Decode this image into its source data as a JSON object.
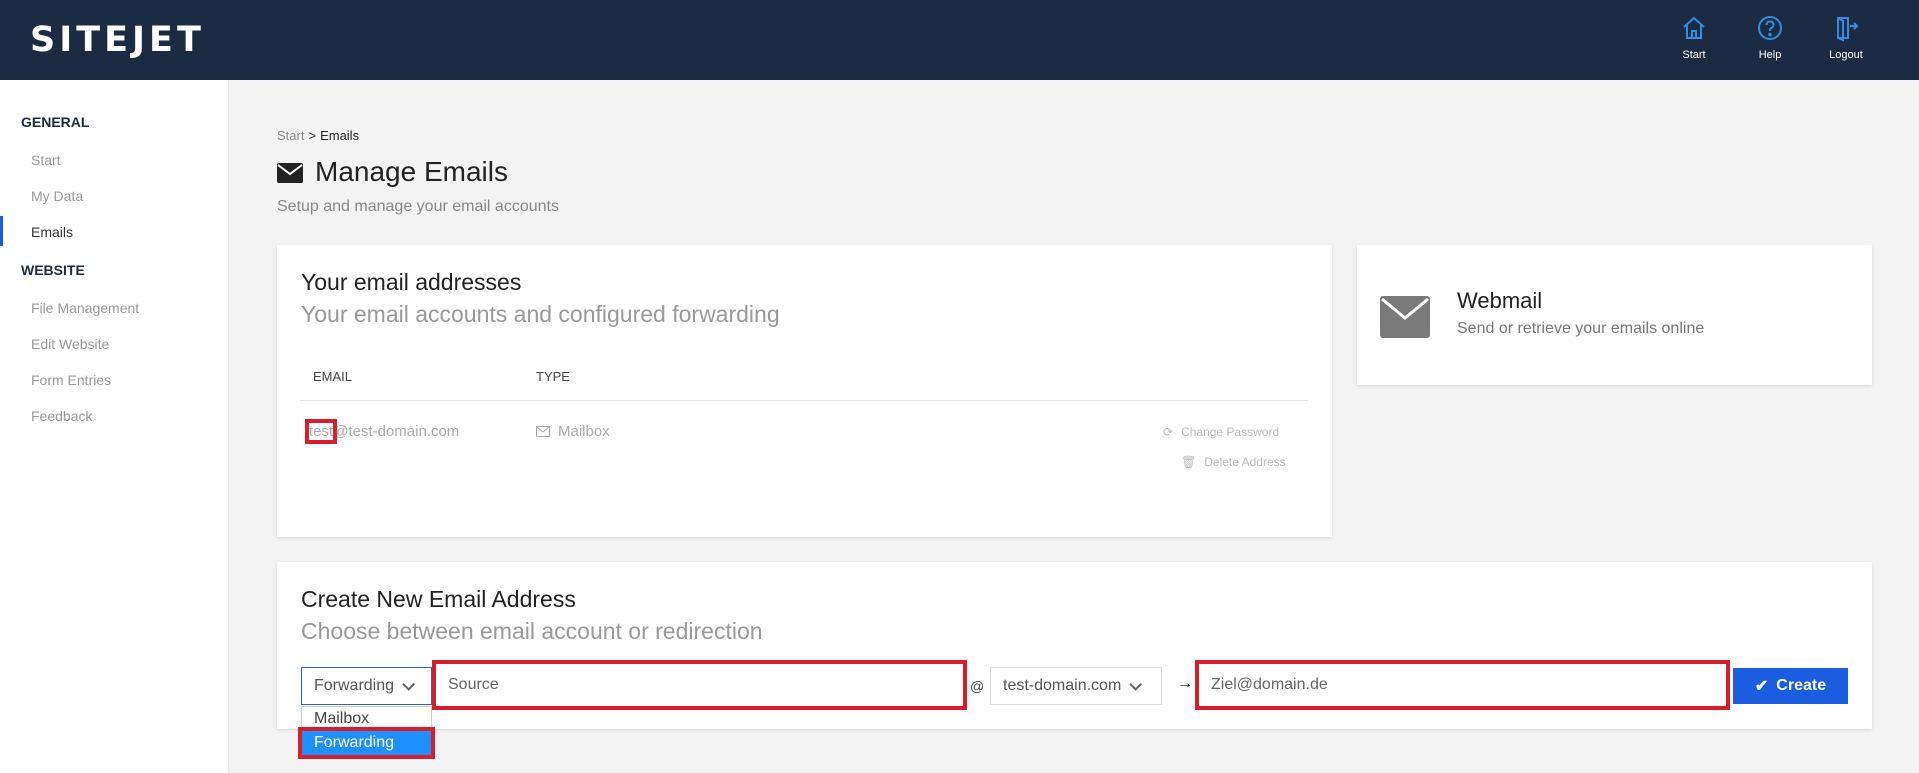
{
  "header": {
    "logo": "SITEJET",
    "nav": [
      {
        "label": "Start",
        "icon": "home-icon"
      },
      {
        "label": "Help",
        "icon": "help-icon"
      },
      {
        "label": "Logout",
        "icon": "logout-icon"
      }
    ]
  },
  "sidebar": {
    "general_heading": "GENERAL",
    "general_items": [
      "Start",
      "My Data",
      "Emails"
    ],
    "website_heading": "WEBSITE",
    "website_items": [
      "File Management",
      "Edit Website",
      "Form Entries",
      "Feedback"
    ],
    "active_item": "Emails"
  },
  "breadcrumb": {
    "start": "Start",
    "separator": ">",
    "current": "Emails"
  },
  "page": {
    "title": "Manage Emails",
    "subtitle": "Setup and manage your email accounts"
  },
  "addresses_card": {
    "title": "Your email addresses",
    "subtitle": "Your email accounts and configured forwarding",
    "columns": [
      "EMAIL",
      "TYPE"
    ],
    "rows": [
      {
        "email_local": "test",
        "email_domain": "@test-domain.com",
        "type": "Mailbox",
        "actions": [
          "Change Password",
          "Delete Address"
        ]
      }
    ]
  },
  "webmail_card": {
    "title": "Webmail",
    "subtitle": "Send or retrieve your emails online"
  },
  "create_card": {
    "title": "Create New Email Address",
    "subtitle": "Choose between email account or redirection",
    "type_select": {
      "value": "Forwarding",
      "options": [
        "Mailbox",
        "Forwarding"
      ],
      "highlighted": "Forwarding"
    },
    "source_placeholder": "Source",
    "at_symbol": "@",
    "domain_select": "test-domain.com",
    "arrow": "→",
    "target_placeholder": "Ziel@domain.de",
    "create_label": "Create"
  },
  "colors": {
    "header_bg": "#1c2b44",
    "accent": "#1a5de0",
    "highlight": "#d81e2a",
    "icon_blue": "#2e8fe0"
  }
}
